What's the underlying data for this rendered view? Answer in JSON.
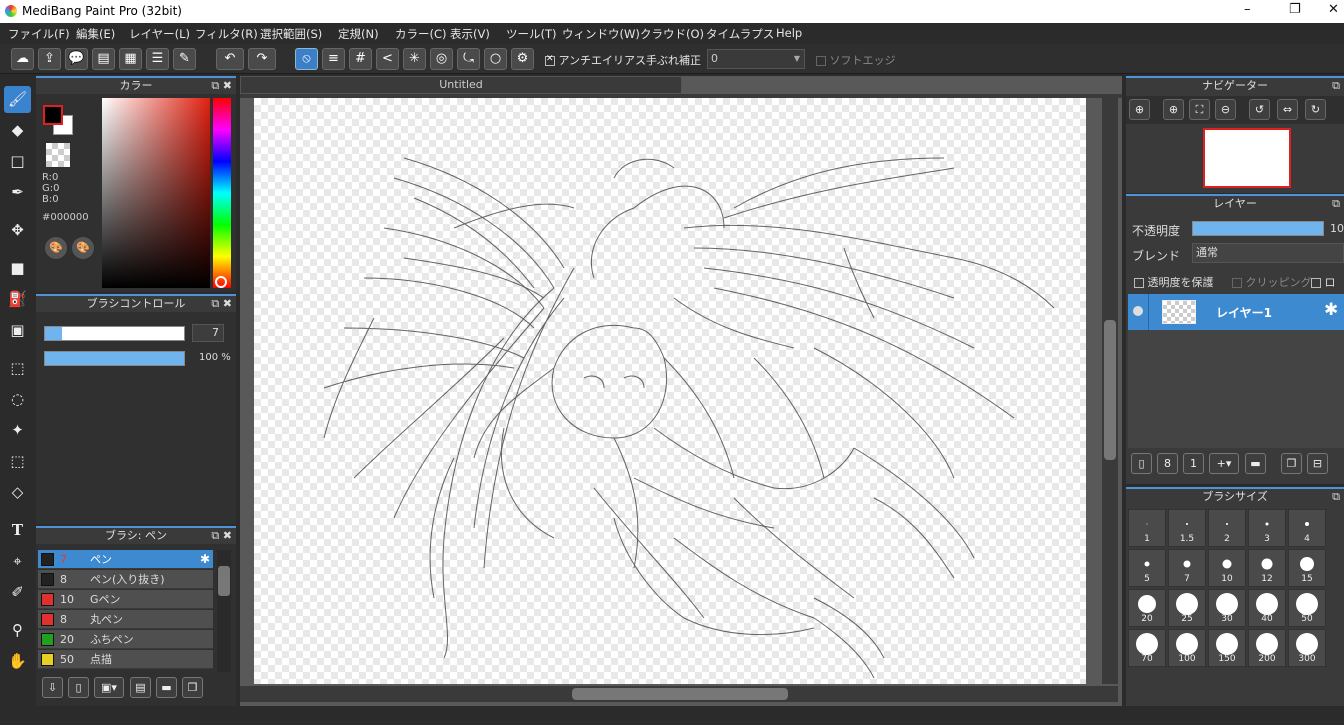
{
  "app": {
    "title": "MediBang Paint Pro (32bit)",
    "min": "–",
    "max": "❐",
    "close": "✕"
  },
  "menu": [
    "ファイル(F)",
    "編集(E)",
    "レイヤー(L)",
    "フィルタ(R)",
    "選択範囲(S)",
    "定規(N)",
    "カラー(C)",
    "表示(V)",
    "ツール(T)",
    "ウィンドウ(W)",
    "クラウド(O)",
    "タイムラプス",
    "Help"
  ],
  "toolbar": {
    "antialias_label": "アンチエイリアス",
    "stabilizer_label": "手ぶれ補正",
    "stabilizer_value": "0",
    "softedge_label": "ソフトエッジ"
  },
  "color_panel": {
    "title": "カラー",
    "r": "R:0",
    "g": "G:0",
    "b": "B:0",
    "hex": "#000000",
    "fg": "#000000",
    "bg": "#ffffff"
  },
  "brush_control": {
    "title": "ブラシコントロール",
    "size": "7",
    "opacity": "100 %"
  },
  "brush_list": {
    "title": "ブラシ: ペン",
    "items": [
      {
        "num": "7",
        "name": "ペン",
        "color": "#222222"
      },
      {
        "num": "8",
        "name": "ペン(入り抜き)",
        "color": "#222222"
      },
      {
        "num": "10",
        "name": "Gペン",
        "color": "#e03030"
      },
      {
        "num": "8",
        "name": "丸ペン",
        "color": "#e03030"
      },
      {
        "num": "20",
        "name": "ふちペン",
        "color": "#20a020"
      },
      {
        "num": "50",
        "name": "点描",
        "color": "#e8d020"
      }
    ]
  },
  "canvas": {
    "tab": "Untitled"
  },
  "navigator": {
    "title": "ナビゲーター"
  },
  "layers": {
    "title": "レイヤー",
    "opacity_label": "不透明度",
    "opacity_value": "10",
    "blend_label": "ブレンド",
    "blend_value": "通常",
    "protect_label": "透明度を保護",
    "clip_label": "クリッピング",
    "lock_label": "ロッ",
    "layer_name": "レイヤー1"
  },
  "brush_size": {
    "title": "ブラシサイズ",
    "sizes": [
      "1",
      "1.5",
      "2",
      "3",
      "4",
      "5",
      "7",
      "10",
      "12",
      "15",
      "20",
      "25",
      "30",
      "40",
      "50",
      "70",
      "100",
      "150",
      "200",
      "300"
    ]
  },
  "colors": {
    "accent": "#3e8ad1",
    "nav_frame": "#e02020"
  }
}
